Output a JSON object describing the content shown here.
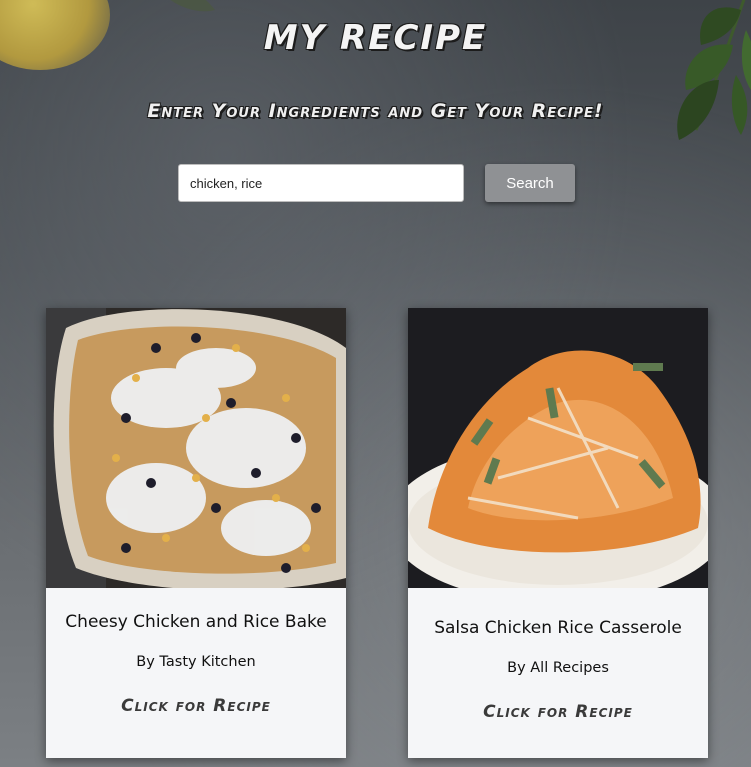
{
  "header": {
    "title": "My Recipe",
    "subtitle": "Enter Your Ingredients and Get Your Recipe!"
  },
  "search": {
    "value": "chicken, rice",
    "button_label": "Search"
  },
  "recipes": [
    {
      "title": "Cheesy Chicken and Rice Bake",
      "source": "By Tasty Kitchen",
      "link_label": "Click for Recipe",
      "image": "cheesy-chicken-rice-bake-photo"
    },
    {
      "title": "Salsa Chicken Rice Casserole",
      "source": "By All Recipes",
      "link_label": "Click for Recipe",
      "image": "salsa-chicken-rice-casserole-photo"
    }
  ],
  "colors": {
    "button_bg": "#8f9194",
    "card_bg": "#f5f6f8",
    "title_text": "#f4f4f4"
  }
}
